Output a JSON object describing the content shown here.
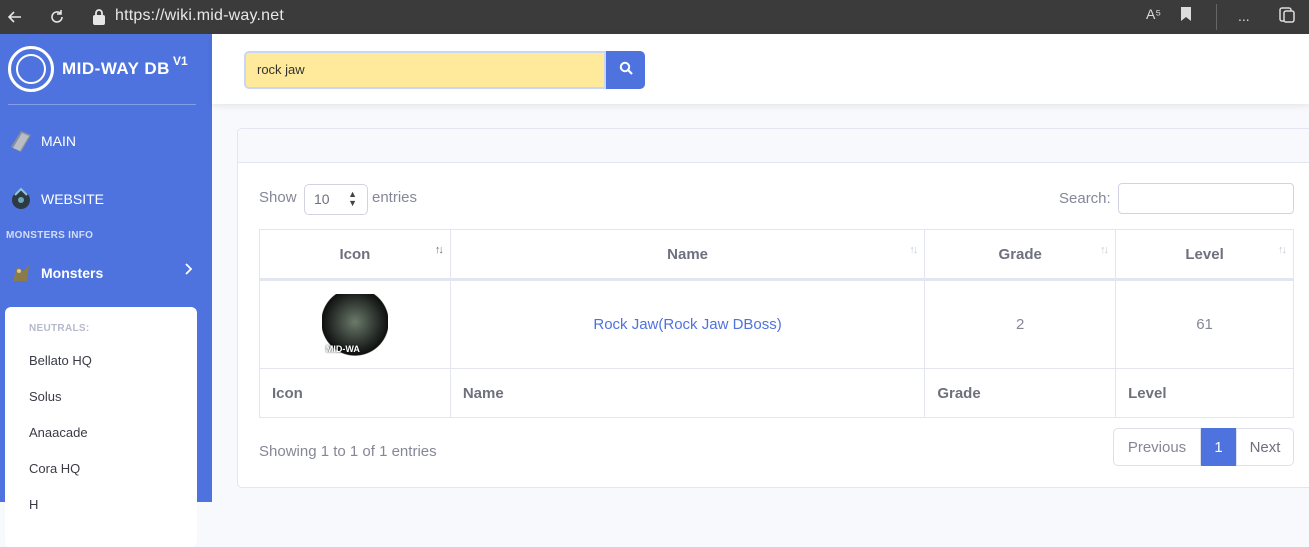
{
  "browser": {
    "url": "https://wiki.mid-way.net",
    "ellipsis": "..."
  },
  "sidebar": {
    "brand": "MID-WAY DB",
    "brand_sup": "V1",
    "items": [
      {
        "label": "MAIN",
        "icon": "book-icon"
      },
      {
        "label": "WEBSITE",
        "icon": "armor-icon"
      }
    ],
    "section_heading": "MONSTERS INFO",
    "monsters": {
      "label": "Monsters",
      "icon": "monster-icon"
    },
    "submenu": {
      "heading": "NEUTRALS:",
      "items": [
        "Bellato HQ",
        "Solus",
        "Anaacade",
        "Cora HQ",
        "H"
      ]
    }
  },
  "search": {
    "value": "rock jaw"
  },
  "table_controls": {
    "show_label": "Show",
    "length_value": "10",
    "entries_label": "entries",
    "search_label": "Search:"
  },
  "table": {
    "columns": [
      "Icon",
      "Name",
      "Grade",
      "Level"
    ],
    "rows": [
      {
        "icon_watermark": "MID-WA",
        "name": "Rock Jaw(Rock Jaw DBoss)",
        "grade": "2",
        "level": "61"
      }
    ]
  },
  "footer": {
    "info": "Showing 1 to 1 of 1 entries",
    "previous": "Previous",
    "current_page": "1",
    "next": "Next"
  },
  "colors": {
    "primary": "#4e73df",
    "search_highlight": "#ffe99b"
  }
}
